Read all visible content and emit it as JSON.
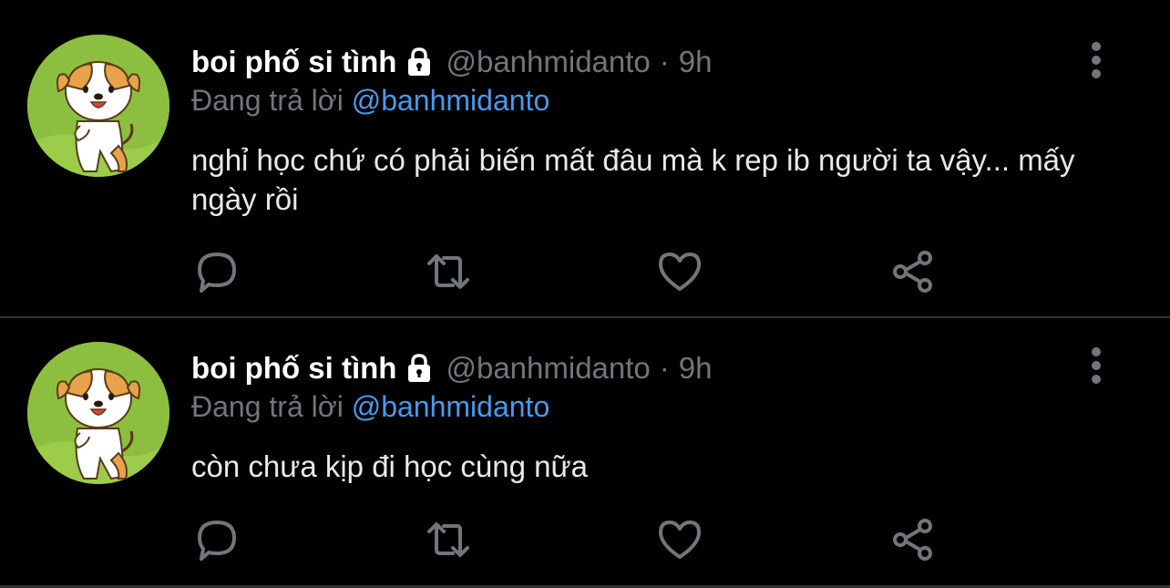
{
  "colors": {
    "background": "#000000",
    "text_primary": "#e7e9ea",
    "text_secondary": "#71767b",
    "link": "#4a99e9",
    "divider": "#2f3336",
    "avatar_bg": "#8cbf3f"
  },
  "tweets": [
    {
      "display_name": "boi phố si tình",
      "handle": "@banhmidanto",
      "separator": "·",
      "time": "9h",
      "replying_label": "Đang trả lời",
      "replying_to": "@banhmidanto",
      "text": "nghỉ học chứ có phải biến mất đâu mà k rep ib người ta vậy... mấy ngày rồi",
      "icons": [
        "lock-icon",
        "more-icon",
        "reply-icon",
        "retweet-icon",
        "like-icon",
        "share-icon"
      ]
    },
    {
      "display_name": "boi phố si tình",
      "handle": "@banhmidanto",
      "separator": "·",
      "time": "9h",
      "replying_label": "Đang trả lời",
      "replying_to": "@banhmidanto",
      "text": "còn chưa kịp đi học cùng nữa",
      "icons": [
        "lock-icon",
        "more-icon",
        "reply-icon",
        "retweet-icon",
        "like-icon",
        "share-icon"
      ]
    }
  ]
}
